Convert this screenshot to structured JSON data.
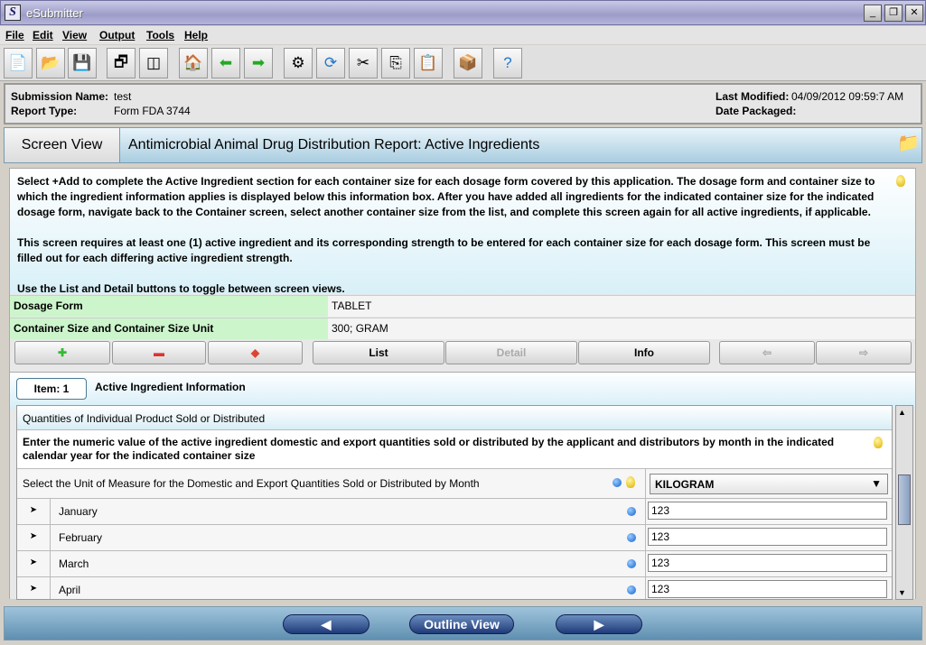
{
  "window": {
    "title": "eSubmitter",
    "logo": "S"
  },
  "menu": [
    "File",
    "Edit",
    "View",
    "Output",
    "Tools",
    "Help"
  ],
  "toolbar": [
    "new-icon",
    "open-icon",
    "save-icon",
    "cascade-icon",
    "tile-icon",
    "home-icon",
    "back-icon",
    "forward-icon",
    "gears-icon",
    "refresh-icon",
    "cut-icon",
    "copy-icon",
    "paste-icon",
    "package-icon",
    "help-icon"
  ],
  "info": {
    "submission_label": "Submission Name:",
    "submission": "test",
    "report_label": "Report Type:",
    "report": "Form FDA 3744",
    "modified_label": "Last Modified:",
    "modified": "04/09/2012 09:59:7 AM",
    "packaged_label": "Date Packaged:",
    "packaged": ""
  },
  "header": {
    "view": "Screen View",
    "title": "Antimicrobial Animal Drug Distribution Report: Active Ingredients"
  },
  "description": [
    "Select +Add to complete the Active Ingredient section for each container size for each dosage form covered by this application. The dosage form and container size to which the ingredient information applies is displayed below this information box. After you have added all ingredients for the indicated container size for the indicated dosage form, navigate back to the Container screen, select another container size from the list, and complete this screen again for all active ingredients, if applicable.",
    "This screen requires at least one (1) active ingredient and its corresponding strength to be entered for each container size for each dosage form. This screen must be filled out for each differing active ingredient strength.",
    "Use the List and Detail buttons to toggle between screen views."
  ],
  "fields": {
    "dosage_label": "Dosage Form",
    "dosage": "TABLET",
    "container_label": "Container Size and Container Size Unit",
    "container": "300; GRAM"
  },
  "buttons": {
    "list": "List",
    "detail": "Detail",
    "info": "Info"
  },
  "item": {
    "tab": "Item: 1",
    "label": "Active Ingredient Information"
  },
  "grid": {
    "section": "Quantities of Individual Product Sold or Distributed",
    "instructions": "Enter the numeric value of the active ingredient domestic and export quantities sold or distributed by the applicant and distributors by month in the indicated calendar year for the indicated container size",
    "unit_label": "Select the Unit of Measure for the Domestic and Export Quantities Sold or Distributed by Month",
    "unit": "KILOGRAM",
    "months": [
      {
        "name": "January",
        "value": "123"
      },
      {
        "name": "February",
        "value": "123"
      },
      {
        "name": "March",
        "value": "123"
      },
      {
        "name": "April",
        "value": "123"
      }
    ]
  },
  "footer": {
    "outline": "Outline View"
  }
}
